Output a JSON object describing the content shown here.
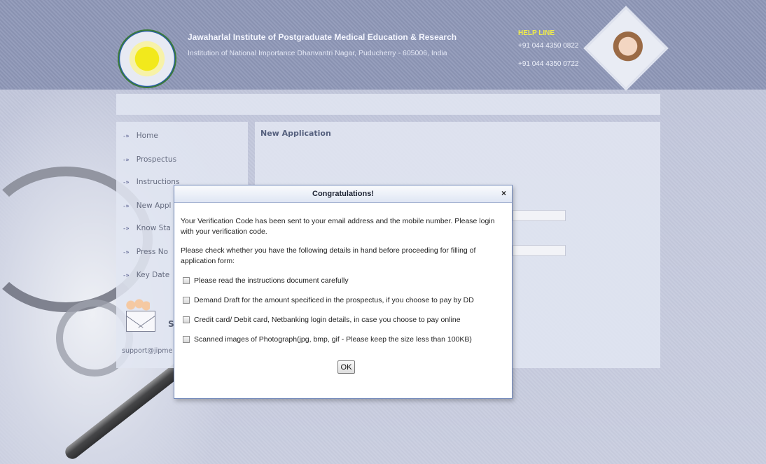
{
  "header": {
    "institution_name": "Jawaharlal Institute of Postgraduate Medical Education & Research",
    "institution_subtitle": "Institution of National Importance Dhanvantri Nagar, Puducherry - 605006, India",
    "helpline_title": "HELP LINE",
    "helpline_phone_1": "+91 044 4350 0822",
    "helpline_phone_2": "+91 044 4350 0722",
    "logo": "institute-seal-logo",
    "agent_image": "helpline-agent-photo"
  },
  "sidebar": {
    "items": [
      {
        "label": "Home",
        "icon": "arrow-bullet-icon"
      },
      {
        "label": "Prospectus",
        "icon": "arrow-bullet-icon"
      },
      {
        "label": "Instructions",
        "icon": "arrow-bullet-icon"
      },
      {
        "label": "New Appl",
        "icon": "arrow-bullet-icon"
      },
      {
        "label": "Know Sta",
        "icon": "arrow-bullet-icon"
      },
      {
        "label": "Press No",
        "icon": "arrow-bullet-icon"
      },
      {
        "label": "Key Date",
        "icon": "arrow-bullet-icon"
      }
    ],
    "arrow_glyph": "-»",
    "support_label": "S",
    "support_email": "support@jipme"
  },
  "main": {
    "heading": "New Application"
  },
  "dialog": {
    "title": "Congratulations!",
    "close_glyph": "×",
    "message_1": "Your Verification Code has been sent to your email address and the mobile number. Please login with your verification code.",
    "message_2": "Please check whether you have the following details in hand before proceeding for filling of application form:",
    "checklist": [
      {
        "label": "Please read the instructions document carefully",
        "checked": false
      },
      {
        "label": "Demand Draft for the amount specificed in the prospectus, if you choose to pay by DD",
        "checked": false
      },
      {
        "label": "Credit card/ Debit card, Netbanking login details, in case you choose to pay online",
        "checked": false
      },
      {
        "label": "Scanned images of Photograph(jpg, bmp, gif - Please keep the size less than 100KB)",
        "checked": false
      }
    ],
    "ok_label": "OK"
  },
  "colors": {
    "header_band": "#8f98b8",
    "helpline_title": "#f0ec4a",
    "dialog_border": "#6f86b8"
  }
}
